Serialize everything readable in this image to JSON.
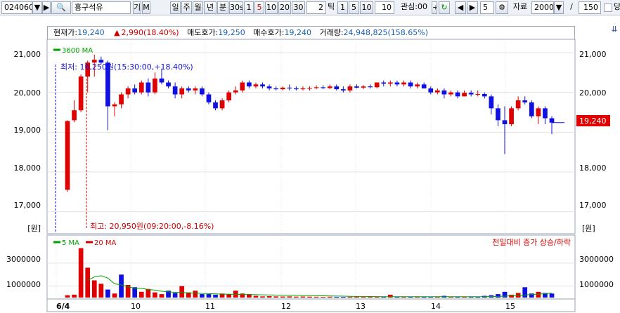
{
  "toolbar": {
    "stock_code": "024060",
    "stock_name": "흥구석유",
    "period_buttons": [
      "일",
      "주",
      "월",
      "년",
      "분"
    ],
    "interval_buttons": [
      "30s",
      "1",
      "5",
      "10",
      "20",
      "30"
    ],
    "selected_interval": "5",
    "tick_value": "2",
    "tick_label": "틱",
    "tick_buttons": [
      "1",
      "5",
      "10"
    ],
    "tick_input": "10",
    "watch_label": "관심:00",
    "nav_count": "5",
    "data_label": "자료",
    "data_count": "2000",
    "page_sep": "/",
    "page_total": "150",
    "extra_label": "당"
  },
  "info": {
    "current_label": "현재가:",
    "current_value": "19,240",
    "change_arrow": "▲",
    "change_value": "2,990(18.40%)",
    "ask_label": "매도호가:",
    "ask_value": "19,250",
    "bid_label": "매수호가:",
    "bid_value": "19,240",
    "volume_label": "거래량:",
    "volume_value": "24,948,825(158.65%)"
  },
  "price_panel": {
    "legend_ma": "3600 MA",
    "unit_label_left": "[원]",
    "unit_label_right": "[원]",
    "y_ticks": [
      "21,000",
      "20,000",
      "19,000",
      "18,000",
      "17,000"
    ],
    "current_price_tag": "19,240",
    "low_annotation": "최저: 16,250원(15:30:00,+18.40%)",
    "high_annotation": "최고: 20,950원(09:20:00,-8.16%)"
  },
  "volume_panel": {
    "legend_ma5": "5 MA",
    "legend_ma20": "20 MA",
    "note": "전일대비 증가 상승/하락",
    "y_ticks": [
      "3000000",
      "1000000"
    ]
  },
  "x_axis": {
    "labels": [
      "6/4",
      "10",
      "11",
      "12",
      "13",
      "14",
      "15"
    ]
  },
  "colors": {
    "up": "#e00000",
    "down": "#1010e0",
    "ma_green": "#00a000",
    "ma_red": "#d00000",
    "price_tag_bg": "#e00000",
    "grid": "#e3e3e3"
  },
  "chart_data": {
    "type": "candlestick",
    "y_range": [
      16500,
      21300
    ],
    "volume_range": [
      0,
      4400000
    ],
    "candles": [
      {
        "o": 17550,
        "h": 19300,
        "l": 17500,
        "c": 19280
      },
      {
        "o": 19300,
        "h": 19800,
        "l": 19250,
        "c": 19550
      },
      {
        "o": 19550,
        "h": 20450,
        "l": 19500,
        "c": 20400
      },
      {
        "o": 20400,
        "h": 20800,
        "l": 20000,
        "c": 20750
      },
      {
        "o": 20750,
        "h": 20950,
        "l": 20400,
        "c": 20820
      },
      {
        "o": 20820,
        "h": 20900,
        "l": 20700,
        "c": 20750
      },
      {
        "o": 20750,
        "h": 20800,
        "l": 19050,
        "c": 19650
      },
      {
        "o": 19650,
        "h": 19750,
        "l": 19400,
        "c": 19700
      },
      {
        "o": 19700,
        "h": 20000,
        "l": 19600,
        "c": 19950
      },
      {
        "o": 19950,
        "h": 20150,
        "l": 19850,
        "c": 20100
      },
      {
        "o": 20100,
        "h": 20200,
        "l": 19950,
        "c": 20000
      },
      {
        "o": 20000,
        "h": 20300,
        "l": 19950,
        "c": 20250
      },
      {
        "o": 20250,
        "h": 20350,
        "l": 19900,
        "c": 20000
      },
      {
        "o": 20000,
        "h": 20500,
        "l": 19950,
        "c": 20350
      },
      {
        "o": 20350,
        "h": 20600,
        "l": 20200,
        "c": 20250
      },
      {
        "o": 20250,
        "h": 20300,
        "l": 20100,
        "c": 20150
      },
      {
        "o": 20150,
        "h": 20250,
        "l": 19850,
        "c": 19950
      },
      {
        "o": 19950,
        "h": 20150,
        "l": 19850,
        "c": 20100
      },
      {
        "o": 20100,
        "h": 20150,
        "l": 20000,
        "c": 20050
      },
      {
        "o": 20050,
        "h": 20150,
        "l": 19950,
        "c": 20100
      },
      {
        "o": 20100,
        "h": 20150,
        "l": 19900,
        "c": 19950
      },
      {
        "o": 19950,
        "h": 20000,
        "l": 19700,
        "c": 19750
      },
      {
        "o": 19750,
        "h": 19800,
        "l": 19550,
        "c": 19600
      },
      {
        "o": 19600,
        "h": 19850,
        "l": 19550,
        "c": 19800
      },
      {
        "o": 19800,
        "h": 20050,
        "l": 19750,
        "c": 20000
      },
      {
        "o": 20000,
        "h": 20150,
        "l": 19950,
        "c": 20050
      },
      {
        "o": 20050,
        "h": 20300,
        "l": 20000,
        "c": 20250
      },
      {
        "o": 20250,
        "h": 20300,
        "l": 20100,
        "c": 20150
      },
      {
        "o": 20150,
        "h": 20250,
        "l": 20100,
        "c": 20200
      },
      {
        "o": 20200,
        "h": 20250,
        "l": 20100,
        "c": 20150
      },
      {
        "o": 20150,
        "h": 20200,
        "l": 20050,
        "c": 20100
      },
      {
        "o": 20100,
        "h": 20150,
        "l": 20050,
        "c": 20080
      },
      {
        "o": 20080,
        "h": 20150,
        "l": 20050,
        "c": 20120
      },
      {
        "o": 20120,
        "h": 20200,
        "l": 20050,
        "c": 20100
      },
      {
        "o": 20100,
        "h": 20150,
        "l": 20050,
        "c": 20080
      },
      {
        "o": 20080,
        "h": 20150,
        "l": 20050,
        "c": 20100
      },
      {
        "o": 20100,
        "h": 20150,
        "l": 20050,
        "c": 20110
      },
      {
        "o": 20110,
        "h": 20180,
        "l": 20080,
        "c": 20130
      },
      {
        "o": 20130,
        "h": 20180,
        "l": 20080,
        "c": 20110
      },
      {
        "o": 20110,
        "h": 20200,
        "l": 20080,
        "c": 20150
      },
      {
        "o": 20150,
        "h": 20200,
        "l": 20050,
        "c": 20080
      },
      {
        "o": 20080,
        "h": 20150,
        "l": 20000,
        "c": 20050
      },
      {
        "o": 20050,
        "h": 20200,
        "l": 20000,
        "c": 20150
      },
      {
        "o": 20150,
        "h": 20200,
        "l": 20100,
        "c": 20120
      },
      {
        "o": 20120,
        "h": 20180,
        "l": 20080,
        "c": 20150
      },
      {
        "o": 20150,
        "h": 20200,
        "l": 20100,
        "c": 20130
      },
      {
        "o": 20130,
        "h": 20250,
        "l": 20100,
        "c": 20250
      },
      {
        "o": 20250,
        "h": 20300,
        "l": 20150,
        "c": 20220
      },
      {
        "o": 20220,
        "h": 20300,
        "l": 20150,
        "c": 20250
      },
      {
        "o": 20250,
        "h": 20300,
        "l": 20150,
        "c": 20200
      },
      {
        "o": 20200,
        "h": 20300,
        "l": 20150,
        "c": 20250
      },
      {
        "o": 20250,
        "h": 20300,
        "l": 20100,
        "c": 20150
      },
      {
        "o": 20150,
        "h": 20250,
        "l": 20100,
        "c": 20200
      },
      {
        "o": 20200,
        "h": 20250,
        "l": 20100,
        "c": 20100
      },
      {
        "o": 20100,
        "h": 20150,
        "l": 19950,
        "c": 20000
      },
      {
        "o": 20000,
        "h": 20100,
        "l": 19950,
        "c": 20050
      },
      {
        "o": 20050,
        "h": 20100,
        "l": 19850,
        "c": 19950
      },
      {
        "o": 19950,
        "h": 20050,
        "l": 19900,
        "c": 20000
      },
      {
        "o": 20000,
        "h": 20050,
        "l": 19850,
        "c": 19900
      },
      {
        "o": 19900,
        "h": 20050,
        "l": 19900,
        "c": 19990
      },
      {
        "o": 19990,
        "h": 20050,
        "l": 19900,
        "c": 19950
      },
      {
        "o": 19950,
        "h": 20050,
        "l": 19900,
        "c": 19960
      },
      {
        "o": 19960,
        "h": 20000,
        "l": 19850,
        "c": 19900
      },
      {
        "o": 19900,
        "h": 19950,
        "l": 19450,
        "c": 19600
      },
      {
        "o": 19600,
        "h": 19700,
        "l": 19150,
        "c": 19300
      },
      {
        "o": 19300,
        "h": 19650,
        "l": 18450,
        "c": 19200
      },
      {
        "o": 19200,
        "h": 19650,
        "l": 19150,
        "c": 19600
      },
      {
        "o": 19600,
        "h": 19900,
        "l": 19550,
        "c": 19800
      },
      {
        "o": 19800,
        "h": 19900,
        "l": 19700,
        "c": 19750
      },
      {
        "o": 19750,
        "h": 19800,
        "l": 19350,
        "c": 19400
      },
      {
        "o": 19400,
        "h": 19650,
        "l": 19200,
        "c": 19600
      },
      {
        "o": 19600,
        "h": 19650,
        "l": 19200,
        "c": 19350
      },
      {
        "o": 19350,
        "h": 19400,
        "l": 18950,
        "c": 19240
      }
    ],
    "volume": [
      200000,
      250000,
      4300000,
      2600000,
      1500000,
      1200000,
      700000,
      350000,
      2000000,
      1100000,
      900000,
      500000,
      750000,
      450000,
      300000,
      600000,
      400000,
      1000000,
      450000,
      600000,
      300000,
      300000,
      250000,
      350000,
      300000,
      600000,
      350000,
      300000,
      150000,
      100000,
      120000,
      100000,
      90000,
      100000,
      80000,
      90000,
      80000,
      70000,
      60000,
      70000,
      60000,
      60000,
      70000,
      80000,
      60000,
      60000,
      70000,
      60000,
      250000,
      80000,
      60000,
      70000,
      60000,
      50000,
      90000,
      60000,
      150000,
      80000,
      70000,
      60000,
      70000,
      60000,
      150000,
      200000,
      300000,
      500000,
      250000,
      400000,
      900000,
      350000,
      500000,
      400000,
      350000
    ],
    "volume_up": [
      true,
      true,
      true,
      true,
      true,
      true,
      false,
      true,
      false,
      true,
      false,
      true,
      true,
      true,
      true,
      false,
      false,
      true,
      true,
      true,
      false,
      false,
      false,
      true,
      true,
      true,
      true,
      true,
      true,
      true,
      true,
      true,
      true,
      true,
      true,
      true,
      true,
      true,
      true,
      true,
      false,
      false,
      true,
      true,
      true,
      true,
      true,
      false,
      true,
      false,
      true,
      false,
      true,
      false,
      false,
      true,
      false,
      true,
      false,
      true,
      false,
      false,
      false,
      false,
      false,
      false,
      true,
      true,
      false,
      false,
      true,
      false,
      false
    ],
    "ma5_volume": [
      null,
      null,
      null,
      1500000,
      1800000,
      1900000,
      1700000,
      1200000,
      1100000,
      950000,
      800000,
      800000,
      700000,
      650000,
      550000,
      500000,
      450000,
      450000,
      400000,
      380000,
      360000,
      340000,
      320000,
      300000,
      290000,
      280000,
      270000,
      260000,
      250000,
      240000,
      230000,
      220000,
      210000,
      200000,
      190000,
      180000,
      170000,
      160000,
      150000,
      140000,
      130000,
      120000,
      110000,
      100000,
      95000,
      90000,
      85000,
      80000,
      80000,
      80000,
      80000,
      80000,
      80000,
      80000,
      80000,
      80000,
      80000,
      80000,
      80000,
      80000,
      80000,
      80000,
      80000,
      90000,
      100000,
      120000,
      150000,
      180000,
      220000,
      260000,
      300000,
      340000,
      380000
    ],
    "ma20_volume": [
      null,
      null,
      null,
      null,
      null,
      null,
      null,
      null,
      null,
      null,
      null,
      null,
      null,
      null,
      null,
      null,
      null,
      null,
      null,
      null,
      null,
      null,
      null,
      null,
      null,
      null,
      null,
      null,
      null,
      null,
      null,
      null,
      null,
      null,
      null,
      null,
      null,
      null,
      null,
      null,
      null,
      null,
      null,
      null,
      null,
      null,
      null,
      null,
      null,
      null,
      null,
      null,
      null,
      null,
      null,
      null,
      null,
      null,
      null,
      null,
      null,
      null,
      null,
      null,
      null,
      null,
      null,
      null,
      null,
      null,
      null,
      null,
      null
    ]
  }
}
